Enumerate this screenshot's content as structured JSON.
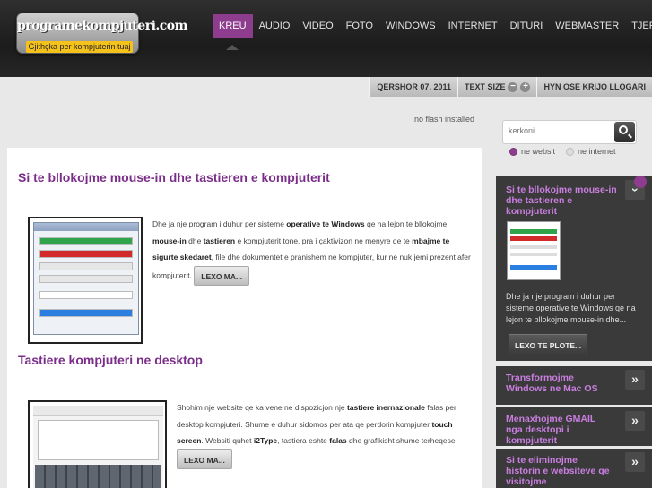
{
  "logo": {
    "name": "programekompjuteri.com",
    "tagline": "Gjithçka per kompjuterin tuaj"
  },
  "nav": {
    "items": [
      {
        "label": "KREU",
        "active": true
      },
      {
        "label": "AUDIO",
        "active": false
      },
      {
        "label": "VIDEO",
        "active": false
      },
      {
        "label": "FOTO",
        "active": false
      },
      {
        "label": "WINDOWS",
        "active": false
      },
      {
        "label": "INTERNET",
        "active": false
      },
      {
        "label": "DITURI",
        "active": false
      },
      {
        "label": "WEBMASTER",
        "active": false
      },
      {
        "label": "TJERA",
        "active": false
      }
    ],
    "active_color": "#8e3d8e"
  },
  "infobar": {
    "date": "QERSHOR 07, 2011",
    "text_size_label": "TEXT SIZE",
    "decrease_symbol": "−",
    "increase_symbol": "+",
    "login_label": "HYN OSE KRIJO LLOGARI"
  },
  "flash_note": "no flash installed",
  "search": {
    "placeholder": "kerkoni...",
    "options": [
      {
        "label": "ne websit",
        "selected": true
      },
      {
        "label": "ne internet",
        "selected": false
      }
    ]
  },
  "articles": [
    {
      "title": "Si te bllokojme mouse-in dhe tastieren e kompjuterit",
      "text_parts": [
        "Dhe ja nje program i duhur per sisteme ",
        "operative te Windows",
        " qe na lejon te bllokojme ",
        "mouse-in",
        " dhe ",
        "tastieren",
        " e kompjuterit tone, pra i çaktivizon ne menyre qe te ",
        "mbajme te sigurte skedaret",
        ", file dhe dokumentet e pranishem ne kompjuter, kur ne nuk jemi prezent afer kompjuterit. "
      ],
      "more_label": "LEXO MA..."
    },
    {
      "title": "Tastiere kompjuteri ne desktop",
      "text_parts": [
        "Shohim nje website qe ka vene ne dispozicjon nje ",
        "tastiere inernazionale",
        " falas per desktop kompjuteri. Shume e duhur sidomos per ata qe perdorin kompjuter ",
        "touch screen",
        ". Websiti quhet ",
        "i2Type",
        ", tastiera eshte ",
        "falas",
        " dhe grafikisht shume terheqese "
      ],
      "more_label": "LEXO MA..."
    }
  ],
  "sidebar": {
    "featured": {
      "title": "Si te bllokojme mouse-in dhe tastieren e kompjuterit",
      "text": "  Dhe ja nje program i duhur per sisteme operative te Windows qe na lejon te bllokojme mouse-in dhe...",
      "more_label": "LEXO TE PLOTE..."
    },
    "items": [
      {
        "title": "Transformojme Windows ne Mac OS"
      },
      {
        "title": "Menaxhojme GMAIL nga desktopi i kompjuterit"
      },
      {
        "title": "Si te eliminojme historin e websiteve qe visitojme"
      }
    ],
    "accent_color": "#c97ee0"
  }
}
